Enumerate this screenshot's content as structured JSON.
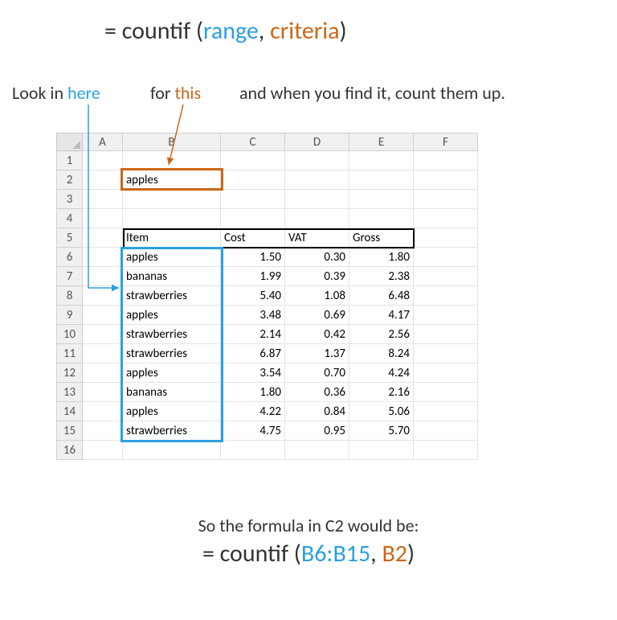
{
  "formula_syntax": {
    "eq": "= ",
    "fn": "countif",
    "open": " (",
    "range": "range",
    "sep": ", ",
    "criteria": "criteria",
    "close": ")"
  },
  "annotations": {
    "look_in": "Look in ",
    "here": "here",
    "for": "for ",
    "this": "this",
    "rest": "and when you find it, count them up."
  },
  "columns": [
    "A",
    "B",
    "C",
    "D",
    "E",
    "F"
  ],
  "rows": [
    "1",
    "2",
    "3",
    "4",
    "5",
    "6",
    "7",
    "8",
    "9",
    "10",
    "11",
    "12",
    "13",
    "14",
    "15",
    "16"
  ],
  "criteria_cell": {
    "value": "apples"
  },
  "headers": {
    "item": "Item",
    "cost": "Cost",
    "vat": "VAT",
    "gross": "Gross"
  },
  "data": [
    {
      "item": "apples",
      "cost": "1.50",
      "vat": "0.30",
      "gross": "1.80"
    },
    {
      "item": "bananas",
      "cost": "1.99",
      "vat": "0.39",
      "gross": "2.38"
    },
    {
      "item": "strawberries",
      "cost": "5.40",
      "vat": "1.08",
      "gross": "6.48"
    },
    {
      "item": "apples",
      "cost": "3.48",
      "vat": "0.69",
      "gross": "4.17"
    },
    {
      "item": "strawberries",
      "cost": "2.14",
      "vat": "0.42",
      "gross": "2.56"
    },
    {
      "item": "strawberries",
      "cost": "6.87",
      "vat": "1.37",
      "gross": "8.24"
    },
    {
      "item": "apples",
      "cost": "3.54",
      "vat": "0.70",
      "gross": "4.24"
    },
    {
      "item": "bananas",
      "cost": "1.80",
      "vat": "0.36",
      "gross": "2.16"
    },
    {
      "item": "apples",
      "cost": "4.22",
      "vat": "0.84",
      "gross": "5.06"
    },
    {
      "item": "strawberries",
      "cost": "4.75",
      "vat": "0.95",
      "gross": "5.70"
    }
  ],
  "summary": {
    "intro": "So the formula in C2 would be:",
    "eq": "= ",
    "fn": "countif",
    "open": " (",
    "range": "B6:B15",
    "sep": ", ",
    "criteria": "B2",
    "close": ")"
  },
  "colors": {
    "range": "#2aa0e0",
    "criteria": "#cc6616"
  }
}
